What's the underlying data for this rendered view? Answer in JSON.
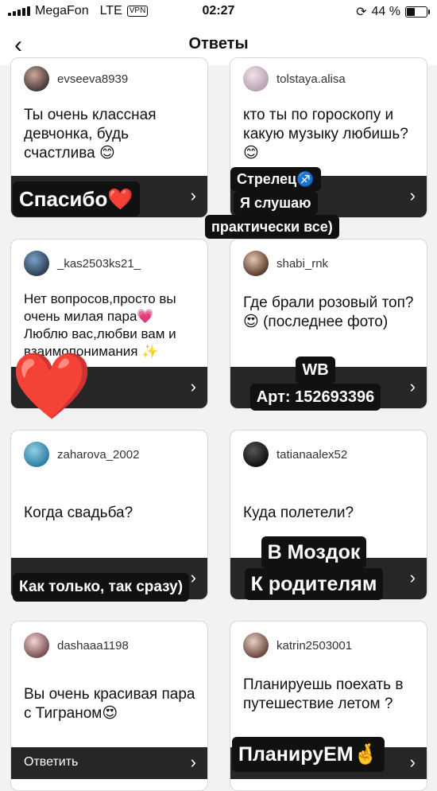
{
  "status_bar": {
    "carrier": "MegaFon",
    "network": "LTE",
    "vpn": "VPN",
    "time": "02:27",
    "battery": "44 %"
  },
  "header": {
    "title": "Ответы",
    "back_icon": "chevron-left-icon"
  },
  "cards": [
    {
      "user": "evseeva8939",
      "question": "Ты очень классная девчонка, будь счастлива 😊"
    },
    {
      "user": "tolstaya.alisa",
      "question": "кто ты по гороскопу и какую музыку любишь? 😊"
    },
    {
      "user": "_kas2503ks21_",
      "question": "Нет вопросов,просто вы очень милая пара💗 Люблю вас,любви вам и взаимопонимания ✨"
    },
    {
      "user": "shabi_rnk",
      "question": "Где брали розовый топ?😍 (последнее фото)"
    },
    {
      "user": "zaharova_2002",
      "question": "Когда свадьба?"
    },
    {
      "user": "tatianaalex52",
      "question": "Куда полетели?"
    },
    {
      "user": "dashaaa1198",
      "question": "Вы очень красивая пара с Тиграном😍",
      "reply_label": "Ответить"
    },
    {
      "user": "katrin2503001",
      "question": "Планируешь поехать в путешествие летом ?"
    }
  ],
  "stickers": {
    "s1": "Спасибо❤️",
    "s2_line1": "Стрелец♐️",
    "s2_line2": "Я слушаю",
    "s2_line3": "практически все)",
    "s3": "❤️",
    "s4_line1": "WB",
    "s4_line2": "Арт: 152693396",
    "s5": "Как только, так сразу)",
    "s6_line1": "В Моздок",
    "s6_line2": "К родителям",
    "s7": "ПланируЕМ🤞"
  },
  "icons": {
    "chevron": "›",
    "back": "‹"
  }
}
